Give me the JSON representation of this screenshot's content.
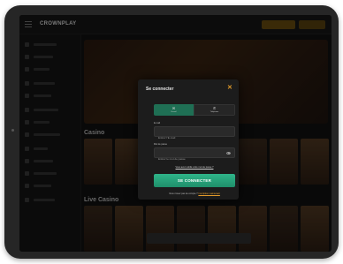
{
  "site": {
    "logo_text": "CROWNPLAY",
    "section_casino": "Casino",
    "section_live": "Live Casino"
  },
  "modal": {
    "title": "Se connecter",
    "tabs": [
      {
        "label": "E-mail",
        "icon": "✉"
      },
      {
        "label": "Téléphone",
        "icon": "✆"
      }
    ],
    "email_label": "E-mail",
    "email_placeholder": "Entrez l'E-mail",
    "password_label": "Mot de passe",
    "password_placeholder": "Entrez le mot de passe",
    "forgot_text": "Vous avez oublié votre mot de passe ?",
    "submit_label": "SE CONNECTER",
    "signup_prompt": "Vous n'avez pas de compte ?",
    "signup_link": "Inscription maintenant",
    "close_icon": "✕"
  },
  "colors": {
    "accent_green": "#2fb58a",
    "accent_orange": "#e29a2a"
  }
}
